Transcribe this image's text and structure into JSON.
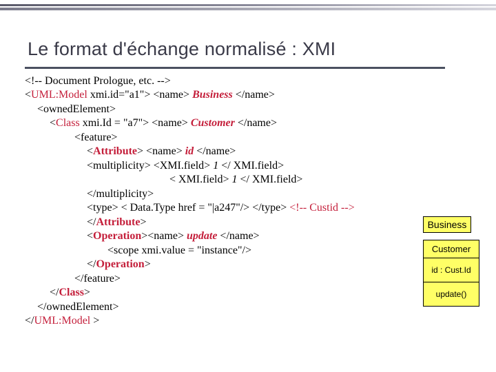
{
  "title": "Le format d'échange normalisé : XMI",
  "xmi": {
    "prologue_comment": "<!-- Document Prologue, etc.  -->",
    "model_open_pre": "<",
    "model_tag": "UML:Model",
    "model_attrs": " xmi.id=\"a1\"> <name> ",
    "model_value": "Business",
    "model_name_close": " </name>",
    "owned_open": "<ownedElement>",
    "class_open_pre": "<",
    "class_tag": "Class",
    "class_attrs": " xmi.Id = \"a7\"> <name> ",
    "class_value": "Customer",
    "class_name_close": " </name>",
    "feature_open": "<feature>",
    "attr_open_pre": "<",
    "attr_tag": "Attribute",
    "attr_open_post": "> <name> ",
    "attr_value": "id",
    "attr_name_close": " </name>",
    "mult_line1_pre": "<multiplicity> <XMI.field> ",
    "mult_val1": "1",
    "mult_line1_post": " </ XMI.field>",
    "mult_line2_pre": "< XMI.field> ",
    "mult_val2": "1",
    "mult_line2_post": " </ XMI.field>",
    "mult_close": "</multiplicity>",
    "type_line": "<type> < Data.Type href = \"|a247\"/> </type> ",
    "type_comment": "<!-- Custid -->",
    "attr_close_pre": "</",
    "attr_close_post": ">",
    "op_open_pre": "<",
    "op_tag": "Operation",
    "op_open_post": "><name> ",
    "op_value": "update",
    "op_name_close": " </name>",
    "scope_line": "<scope xmi.value = \"instance\"/>",
    "op_close_pre": "</",
    "op_close_post": ">",
    "feature_close": "</feature>",
    "class_close_pre": "</",
    "class_close_post": ">",
    "owned_close": "</ownedElement>",
    "model_close_pre": "</",
    "model_close_post": " >"
  },
  "diagram": {
    "package": "Business",
    "class_name": "Customer",
    "attr_row": "id : Cust.Id",
    "op_row": "update()"
  }
}
